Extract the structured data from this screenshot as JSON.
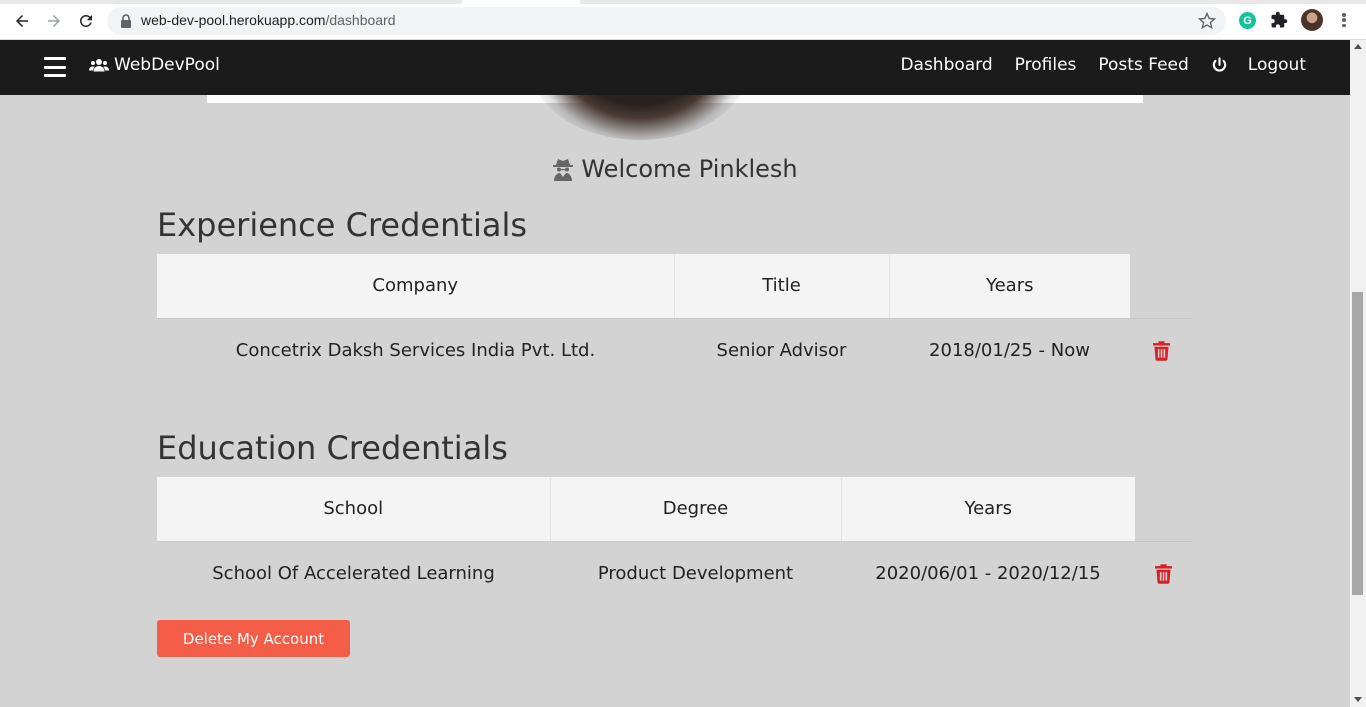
{
  "browser": {
    "url_host": "web-dev-pool.herokuapp.com",
    "url_path": "/dashboard",
    "extension_badge": "G"
  },
  "navbar": {
    "brand": "WebDevPool",
    "links": [
      "Dashboard",
      "Profiles",
      "Posts Feed"
    ],
    "logout": "Logout"
  },
  "welcome": "Welcome Pinklesh",
  "experience": {
    "title": "Experience Credentials",
    "headers": [
      "Company",
      "Title",
      "Years"
    ],
    "rows": [
      {
        "company": "Concetrix Daksh Services India Pvt. Ltd.",
        "title": "Senior Advisor",
        "years": "2018/01/25 - Now"
      }
    ]
  },
  "education": {
    "title": "Education Credentials",
    "headers": [
      "School",
      "Degree",
      "Years"
    ],
    "rows": [
      {
        "school": "School Of Accelerated Learning",
        "degree": "Product Development",
        "years": "2020/06/01 - 2020/12/15"
      }
    ]
  },
  "delete_account_label": "Delete My Account",
  "colors": {
    "navbar_bg": "#1b1b1b",
    "page_bg": "#d3d3d3",
    "danger": "#dc1f26",
    "delete_button": "#f45d48"
  }
}
